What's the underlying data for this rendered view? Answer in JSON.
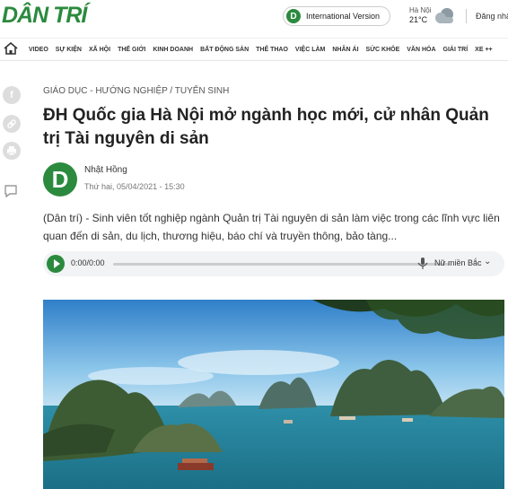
{
  "brand": {
    "logo": "DÂN TRÍ",
    "accent": "#2b8a3e"
  },
  "header": {
    "international_label": "International Version",
    "weather_city": "Hà Nội",
    "weather_temp": "21°C",
    "login_label": "Đăng nhậ"
  },
  "nav": {
    "items": [
      "VIDEO",
      "SỰ KIỆN",
      "XÃ HỘI",
      "THẾ GIỚI",
      "KINH DOANH",
      "BẤT ĐỘNG SẢN",
      "THỂ THAO",
      "VIỆC LÀM",
      "NHÂN ÁI",
      "SỨC KHỎE",
      "VĂN HÓA",
      "GIẢI TRÍ",
      "XE ++"
    ]
  },
  "share": {
    "icons": [
      "facebook-icon",
      "link-icon",
      "print-icon",
      "comment-icon"
    ]
  },
  "article": {
    "breadcrumb": "GIÁO DỤC - HƯỚNG NGHIỆP / TUYỂN SINH",
    "title": "ĐH Quốc gia Hà Nội mở ngành học mới, cử nhân Quản trị Tài nguyên di sản",
    "author": "Nhật Hồng",
    "author_initial": "D",
    "date": "Thứ hai, 05/04/2021 - 15:30",
    "sapo": "(Dân trí) - Sinh viên tốt nghiệp ngành Quản trị Tài nguyên di sản làm việc trong các lĩnh vực liên quan đến di sản, du lịch, thương hiệu, báo chí và truyền thông, bảo tàng..."
  },
  "audio": {
    "time": "0:00/0:00",
    "voice": "Nữ miền Bắc",
    "progress": 0
  }
}
